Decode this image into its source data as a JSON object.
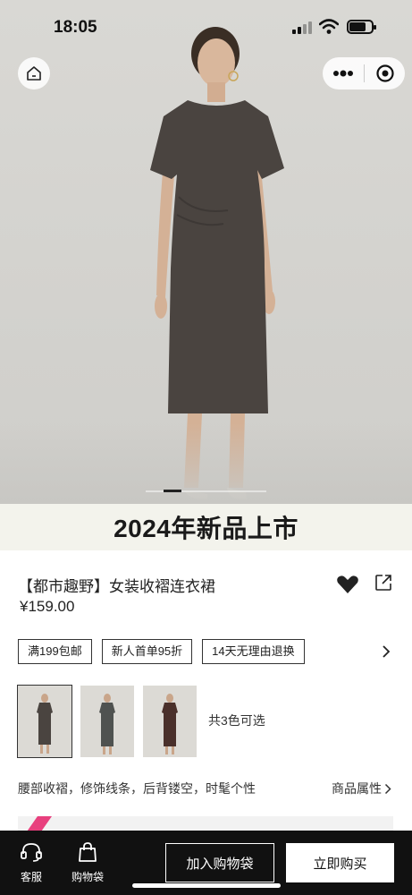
{
  "status_bar": {
    "time": "18:05"
  },
  "hero": {
    "home_icon": "home-icon",
    "more_icon": "more-dots-icon",
    "close_icon": "miniapp-close-icon",
    "image_alt": "model-wearing-dark-brown-dress"
  },
  "banner": {
    "text": "2024年新品上市"
  },
  "product": {
    "title": "【都市趣野】女装收褶连衣裙",
    "price": "¥159.00",
    "favorite_icon": "heart-icon",
    "share_icon": "share-icon"
  },
  "tags": [
    "满199包邮",
    "新人首单95折",
    "14天无理由退换"
  ],
  "colors": {
    "count_text": "共3色可选",
    "swatches": [
      {
        "name": "brown",
        "color": "#4a4440"
      },
      {
        "name": "gray",
        "color": "#4f5250"
      },
      {
        "name": "maroon",
        "color": "#4a302b"
      }
    ]
  },
  "description": {
    "text": "腰部收褶，修饰线条，后背镂空，时髦个性",
    "attributes_link": "商品属性"
  },
  "bottom_bar": {
    "service_label": "客服",
    "bag_label": "购物袋",
    "add_to_bag": "加入购物袋",
    "buy_now": "立即购买"
  },
  "colors_theme": {
    "accent": "#111111",
    "promo_pink": "#e8407e"
  }
}
